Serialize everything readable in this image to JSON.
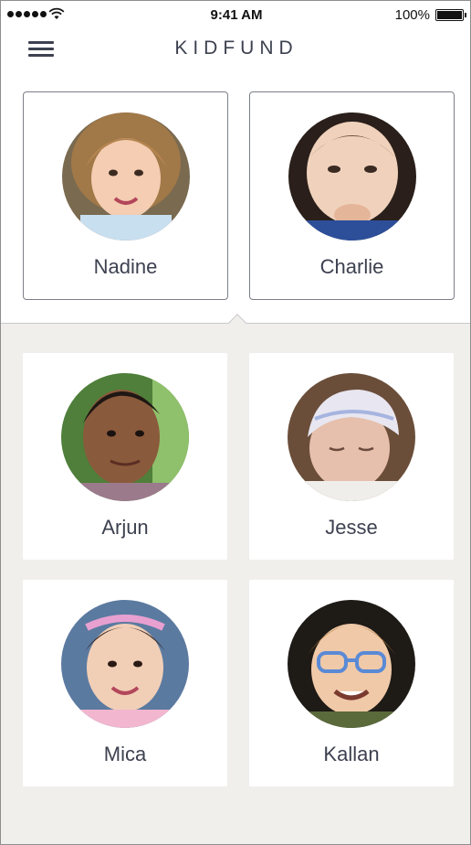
{
  "status": {
    "time": "9:41 AM",
    "battery": "100%"
  },
  "app": {
    "brand": "KIDFUND"
  },
  "kids_selected": [
    {
      "name": "Nadine"
    },
    {
      "name": "Charlie"
    }
  ],
  "kids": [
    {
      "name": "Arjun"
    },
    {
      "name": "Jesse"
    },
    {
      "name": "Mica"
    },
    {
      "name": "Kallan"
    }
  ]
}
